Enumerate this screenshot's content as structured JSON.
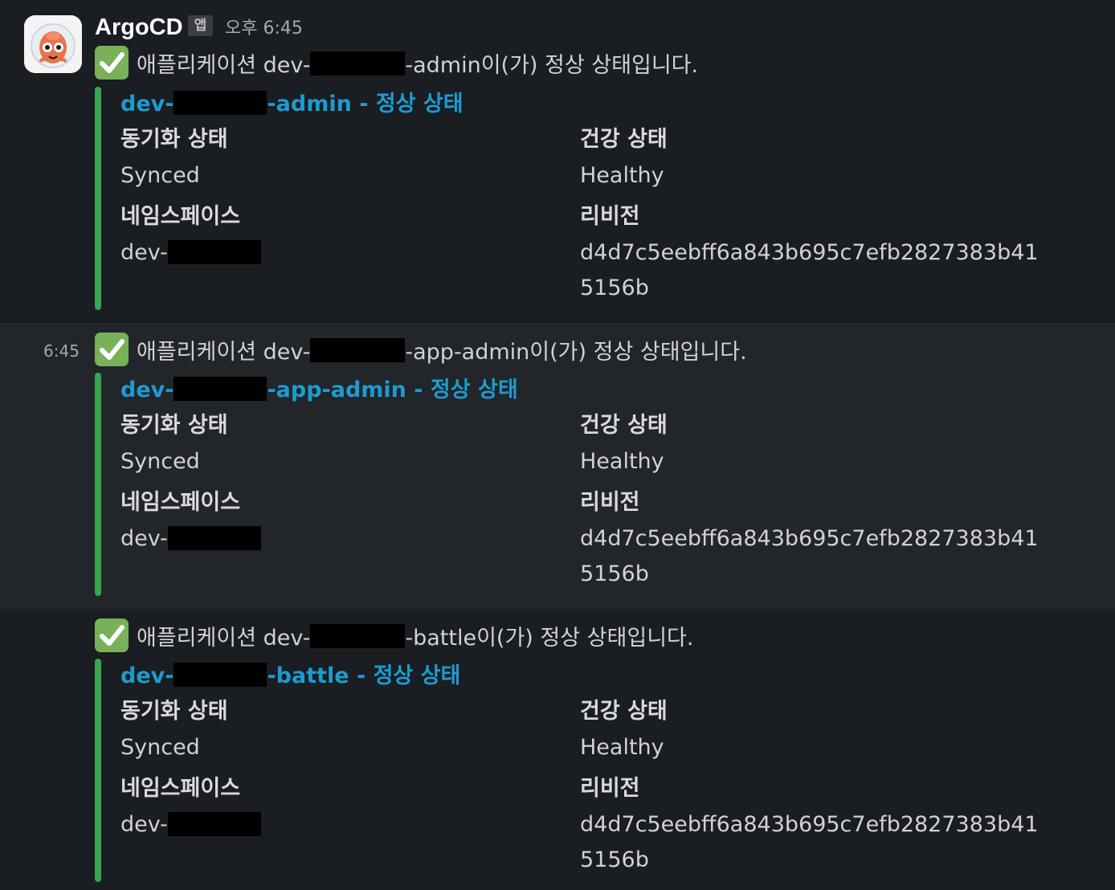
{
  "sender": {
    "name": "ArgoCD",
    "badge": "앱",
    "time": "오후 6:45"
  },
  "messages": [
    {
      "hover_time": "",
      "text_prefix": "애플리케이션 dev-",
      "text_suffix": "-admin이(가) 정상 상태입니다.",
      "title_prefix": "dev-",
      "title_suffix": "-admin - 정상 상태",
      "sync_label": "동기화 상태",
      "sync_value": "Synced",
      "health_label": "건강 상태",
      "health_value": "Healthy",
      "namespace_label": "네임스페이스",
      "namespace_value": "dev-",
      "revision_label": "리비전",
      "revision_line1": "d4d7c5eebff6a843b695c7efb2827383b41",
      "revision_line2": "5156b"
    },
    {
      "hover_time": "6:45",
      "text_prefix": "애플리케이션 dev-",
      "text_suffix": "-app-admin이(가) 정상 상태입니다.",
      "title_prefix": "dev-",
      "title_suffix": "-app-admin - 정상 상태",
      "sync_label": "동기화 상태",
      "sync_value": "Synced",
      "health_label": "건강 상태",
      "health_value": "Healthy",
      "namespace_label": "네임스페이스",
      "namespace_value": "dev-",
      "revision_label": "리비전",
      "revision_line1": "d4d7c5eebff6a843b695c7efb2827383b41",
      "revision_line2": "5156b"
    },
    {
      "hover_time": "",
      "text_prefix": "애플리케이션 dev-",
      "text_suffix": "-battle이(가) 정상 상태입니다.",
      "title_prefix": "dev-",
      "title_suffix": "-battle - 정상 상태",
      "sync_label": "동기화 상태",
      "sync_value": "Synced",
      "health_label": "건강 상태",
      "health_value": "Healthy",
      "namespace_label": "네임스페이스",
      "namespace_value": "dev-",
      "revision_label": "리비전",
      "revision_line1": "d4d7c5eebff6a843b695c7efb2827383b41",
      "revision_line2": "5156b"
    }
  ],
  "colors": {
    "background": "#1a1d21",
    "hover_background": "#222529",
    "attachment_bar": "#36a64f",
    "title_link": "#1d9bd1",
    "check_emoji": "#78b159"
  },
  "icons": {
    "avatar": "argocd-octopus-icon",
    "status": "white-check-mark-icon"
  }
}
